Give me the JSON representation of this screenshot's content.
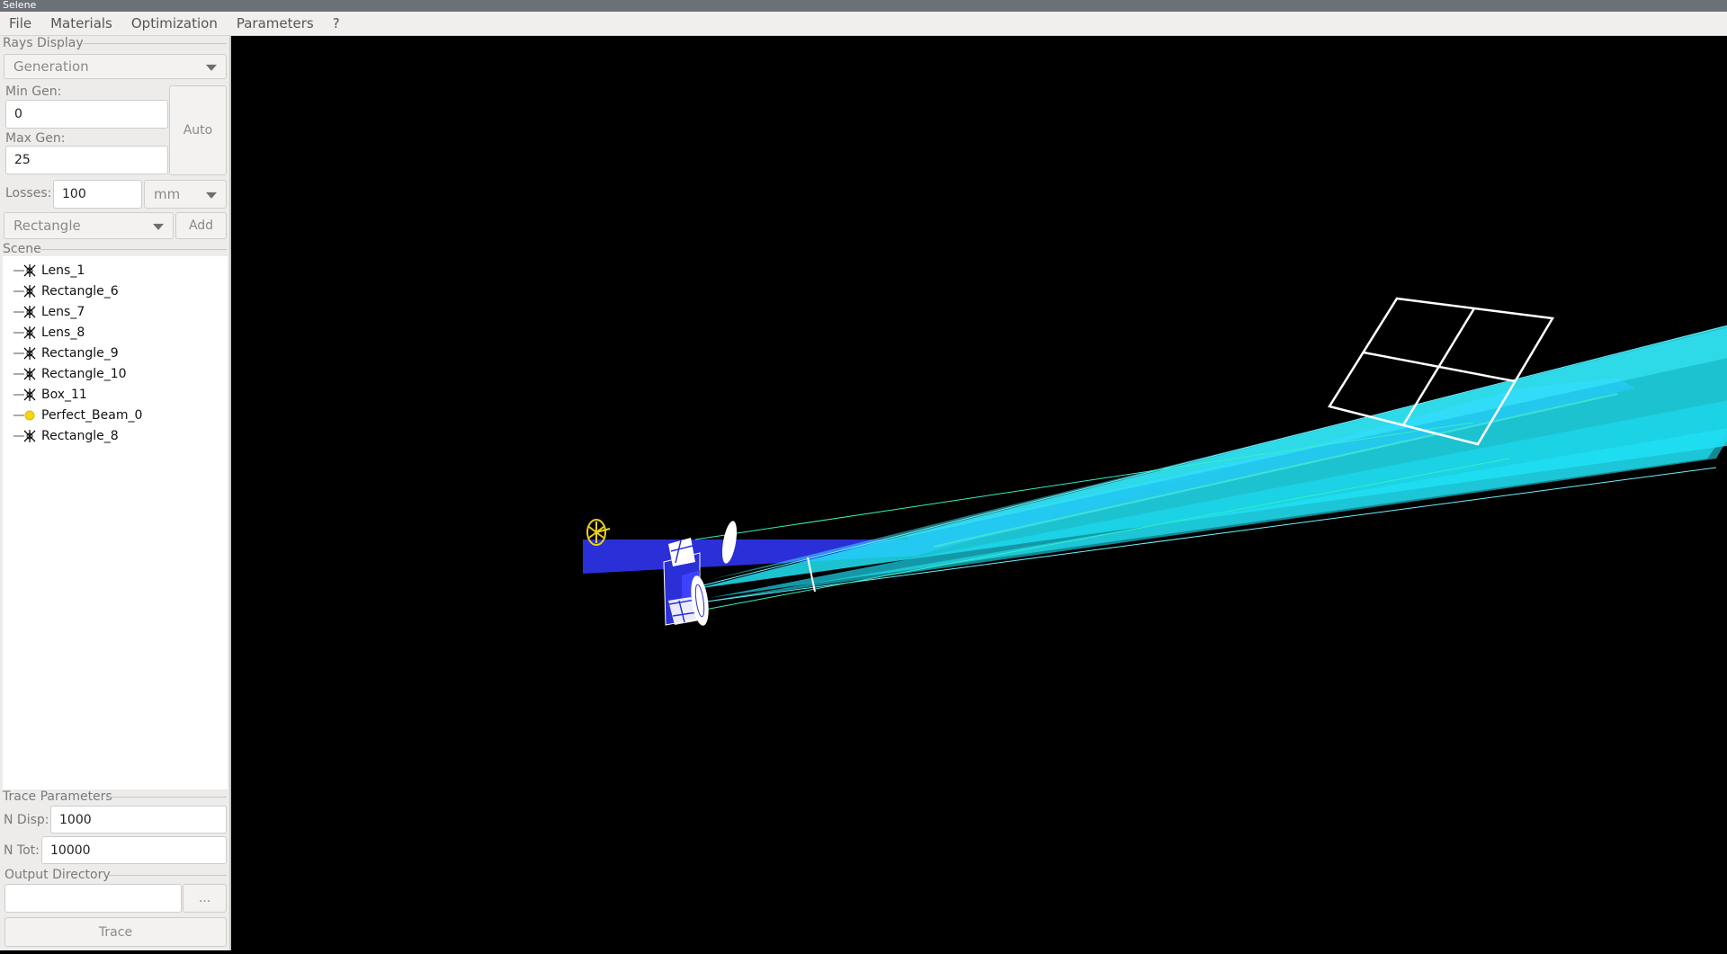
{
  "window": {
    "title": "Selene"
  },
  "menu": [
    "File",
    "Materials",
    "Optimization",
    "Parameters",
    "?"
  ],
  "rays_display": {
    "group_label": "Rays Display",
    "mode": "Generation",
    "min_gen_label": "Min Gen:",
    "min_gen_value": "0",
    "max_gen_label": "Max Gen:",
    "max_gen_value": "25",
    "auto_label": "Auto",
    "losses_label": "Losses:",
    "losses_value": "100",
    "losses_unit": "mm"
  },
  "add_object": {
    "type": "Rectangle",
    "add_label": "Add"
  },
  "scene": {
    "group_label": "Scene",
    "items": [
      {
        "label": "Lens_1",
        "icon": "optical-element-icon"
      },
      {
        "label": "Rectangle_6",
        "icon": "optical-element-icon"
      },
      {
        "label": "Lens_7",
        "icon": "optical-element-icon"
      },
      {
        "label": "Lens_8",
        "icon": "optical-element-icon"
      },
      {
        "label": "Rectangle_9",
        "icon": "optical-element-icon"
      },
      {
        "label": "Rectangle_10",
        "icon": "optical-element-icon"
      },
      {
        "label": "Box_11",
        "icon": "optical-element-icon"
      },
      {
        "label": "Perfect_Beam_0",
        "icon": "light-source-icon"
      },
      {
        "label": "Rectangle_8",
        "icon": "optical-element-icon"
      }
    ]
  },
  "trace_parameters": {
    "group_label": "Trace Parameters",
    "n_disp_label": "N Disp:",
    "n_disp_value": "1000",
    "n_tot_label": "N Tot:",
    "n_tot_value": "10000"
  },
  "output_directory": {
    "group_label": "Output Directory",
    "path_value": "",
    "browse_label": "...",
    "trace_label": "Trace"
  },
  "colors": {
    "viewport_bg": "#000000",
    "ray_cyan": "#22e4f6",
    "ray_blue": "#2b2fd8",
    "source_yellow": "#e8d21a",
    "element_white": "#ffffff"
  }
}
